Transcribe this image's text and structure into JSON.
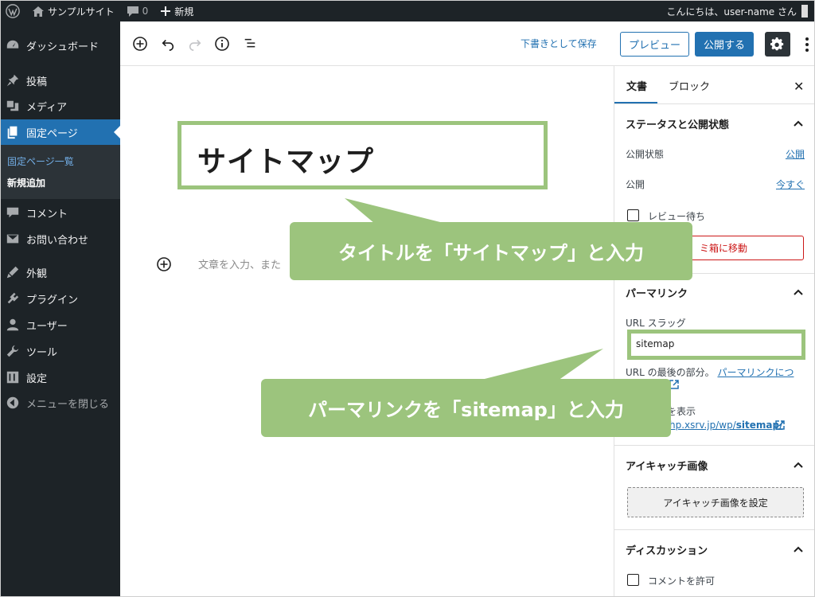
{
  "admin_bar": {
    "site_name": "サンプルサイト",
    "comments_count": "0",
    "new_label": "新規",
    "greeting": "こんにちは、user-name さん"
  },
  "sidebar": {
    "items": [
      {
        "label": "ダッシュボード",
        "icon": "dashboard-icon"
      },
      {
        "label": "投稿",
        "icon": "pin-icon"
      },
      {
        "label": "メディア",
        "icon": "media-icon"
      },
      {
        "label": "固定ページ",
        "icon": "pages-icon"
      },
      {
        "label": "コメント",
        "icon": "comment-icon"
      },
      {
        "label": "お問い合わせ",
        "icon": "mail-icon"
      },
      {
        "label": "外観",
        "icon": "appearance-icon"
      },
      {
        "label": "プラグイン",
        "icon": "plugin-icon"
      },
      {
        "label": "ユーザー",
        "icon": "user-icon"
      },
      {
        "label": "ツール",
        "icon": "wrench-icon"
      },
      {
        "label": "設定",
        "icon": "settings-icon"
      },
      {
        "label": "メニューを閉じる",
        "icon": "collapse-icon"
      }
    ],
    "submenu": [
      "固定ページ一覧",
      "新規追加"
    ]
  },
  "toolbar": {
    "save_draft": "下書きとして保存",
    "preview": "プレビュー",
    "publish": "公開する"
  },
  "editor": {
    "title": "サイトマップ",
    "placeholder": "文章を入力、また"
  },
  "panel": {
    "tabs": [
      "文書",
      "ブロック"
    ],
    "status_section": {
      "title": "ステータスと公開状態",
      "visibility_label": "公開状態",
      "visibility_value": "公開",
      "publish_label": "公開",
      "publish_value": "今すぐ",
      "pending_review": "レビュー待ち",
      "trash_button": "ミ箱に移動"
    },
    "permalink_section": {
      "title": "パーマリンク",
      "slug_label": "URL スラッグ",
      "slug_value": "sitemap",
      "slug_help_prefix": "URL の最後の部分。",
      "slug_help_link": "パーマリンクにつ",
      "view_page_label": "ジを表示",
      "view_page_url_prefix": "hp.xsrv.jp/wp/",
      "view_page_url_bold": "sitemap/"
    },
    "featured_section": {
      "title": "アイキャッチ画像",
      "button": "アイキャッチ画像を設定"
    },
    "discussion_section": {
      "title": "ディスカッション",
      "allow_comments": "コメントを許可"
    }
  },
  "callouts": {
    "title_hint": "タイトルを「サイトマップ」と入力",
    "permalink_hint": "パーマリンクを「sitemap」と入力"
  },
  "colors": {
    "admin_dark": "#1d2327",
    "accent_blue": "#2271b1",
    "callout_green": "#9cc47d",
    "danger_red": "#cc1818"
  }
}
